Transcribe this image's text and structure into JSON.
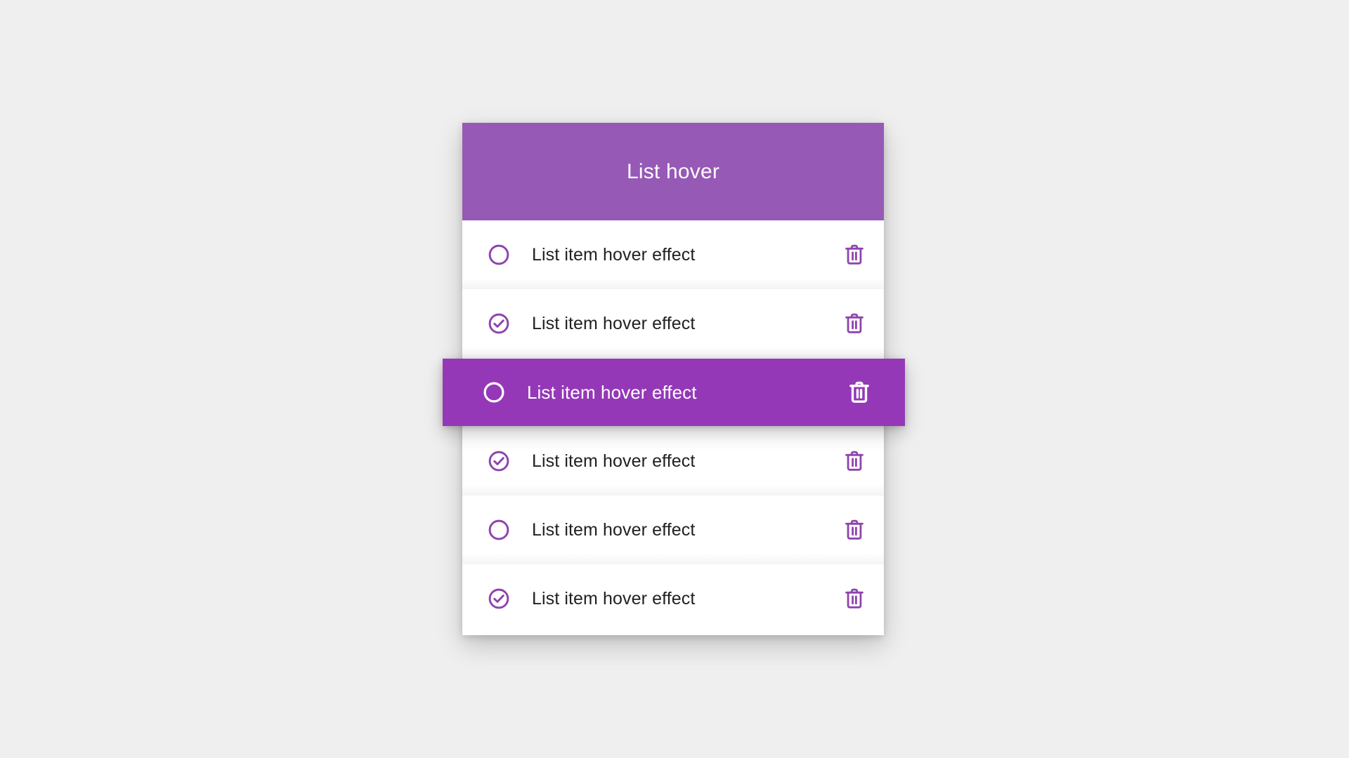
{
  "background_color": "#efefef",
  "card": {
    "header": {
      "title": "List hover",
      "background_color": "#9659b6",
      "text_color": "#fdfdfd"
    },
    "accent_color": "#8e44ad",
    "hover_background_color": "#9438b8",
    "surface_color": "#ffffff",
    "text_color": "#212121",
    "rows": [
      {
        "label": "List item hover effect",
        "status_icon": "circle-outline-icon",
        "checked": false,
        "hovered": false,
        "delete_icon": "trash-icon"
      },
      {
        "label": "List item hover effect",
        "status_icon": "check-circle-icon",
        "checked": true,
        "hovered": false,
        "delete_icon": "trash-icon"
      },
      {
        "label": "List item hover effect",
        "status_icon": "circle-outline-icon",
        "checked": false,
        "hovered": true,
        "delete_icon": "trash-icon"
      },
      {
        "label": "List item hover effect",
        "status_icon": "check-circle-icon",
        "checked": true,
        "hovered": false,
        "delete_icon": "trash-icon"
      },
      {
        "label": "List item hover effect",
        "status_icon": "circle-outline-icon",
        "checked": false,
        "hovered": false,
        "delete_icon": "trash-icon"
      },
      {
        "label": "List item hover effect",
        "status_icon": "check-circle-icon",
        "checked": true,
        "hovered": false,
        "delete_icon": "trash-icon"
      }
    ]
  }
}
